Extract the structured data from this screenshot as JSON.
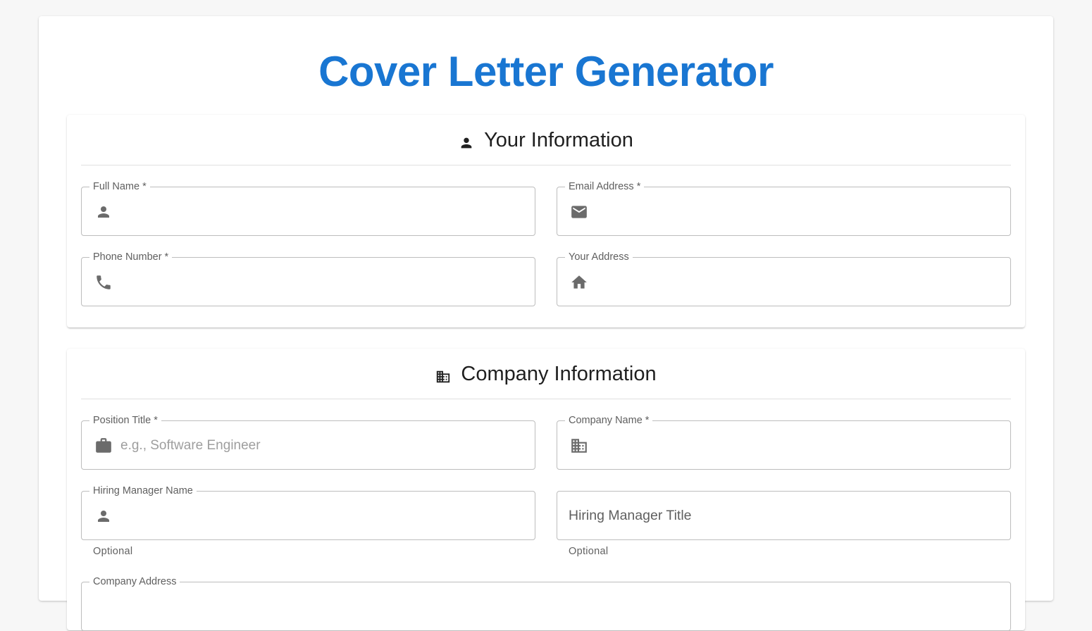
{
  "page": {
    "title": "Cover Letter Generator",
    "accent_color": "#1976d2"
  },
  "your_info": {
    "heading": "Your Information",
    "heading_icon": "person-icon",
    "fields": {
      "full_name": {
        "label": "Full Name *",
        "icon": "person-icon",
        "value": "",
        "placeholder": ""
      },
      "email": {
        "label": "Email Address *",
        "icon": "email-icon",
        "value": "",
        "placeholder": ""
      },
      "phone": {
        "label": "Phone Number *",
        "icon": "phone-icon",
        "value": "",
        "placeholder": ""
      },
      "address": {
        "label": "Your Address",
        "icon": "home-icon",
        "value": "",
        "placeholder": ""
      }
    }
  },
  "company_info": {
    "heading": "Company Information",
    "heading_icon": "building-icon",
    "fields": {
      "position_title": {
        "label": "Position Title *",
        "icon": "briefcase-icon",
        "value": "",
        "placeholder": "e.g., Software Engineer"
      },
      "company_name": {
        "label": "Company Name *",
        "icon": "building-icon",
        "value": "",
        "placeholder": ""
      },
      "hiring_manager_name": {
        "label": "Hiring Manager Name",
        "icon": "person-icon",
        "value": "",
        "placeholder": "",
        "helper": "Optional"
      },
      "hiring_manager_title": {
        "label": "Hiring Manager Title",
        "value": "",
        "helper": "Optional"
      },
      "company_address": {
        "label": "Company Address"
      }
    }
  }
}
